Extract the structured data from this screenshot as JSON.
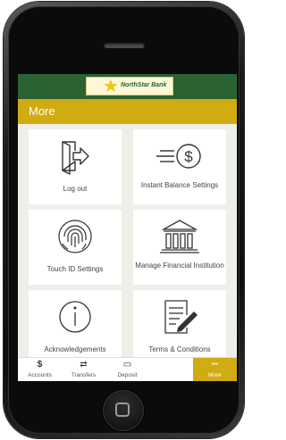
{
  "bank": {
    "name": "NorthStar Bank"
  },
  "titlebar": {
    "title": "More"
  },
  "tiles": [
    {
      "label": "Log out",
      "icon": "logout-door-icon"
    },
    {
      "label": "Instant Balance Settings",
      "icon": "instant-balance-dollar-icon"
    },
    {
      "label": "Touch ID Settings",
      "icon": "fingerprint-icon"
    },
    {
      "label": "Manage Financial Institution",
      "icon": "bank-building-icon"
    },
    {
      "label": "Acknowledgements",
      "icon": "info-icon"
    },
    {
      "label": "Terms & Conditions",
      "icon": "document-pen-icon"
    }
  ],
  "tabs": [
    {
      "label": "Accounts",
      "icon": "dollar-icon",
      "glyph": "$"
    },
    {
      "label": "Transfers",
      "icon": "transfer-icon",
      "glyph": "⇄"
    },
    {
      "label": "Deposit",
      "icon": "check-deposit-icon",
      "glyph": "▭"
    },
    {
      "label": "More",
      "icon": "more-dots-icon",
      "glyph": "•••",
      "active": true
    }
  ],
  "colors": {
    "header_green": "#2b6231",
    "accent_gold": "#d1ab12",
    "grid_bg": "#f0eee8"
  }
}
